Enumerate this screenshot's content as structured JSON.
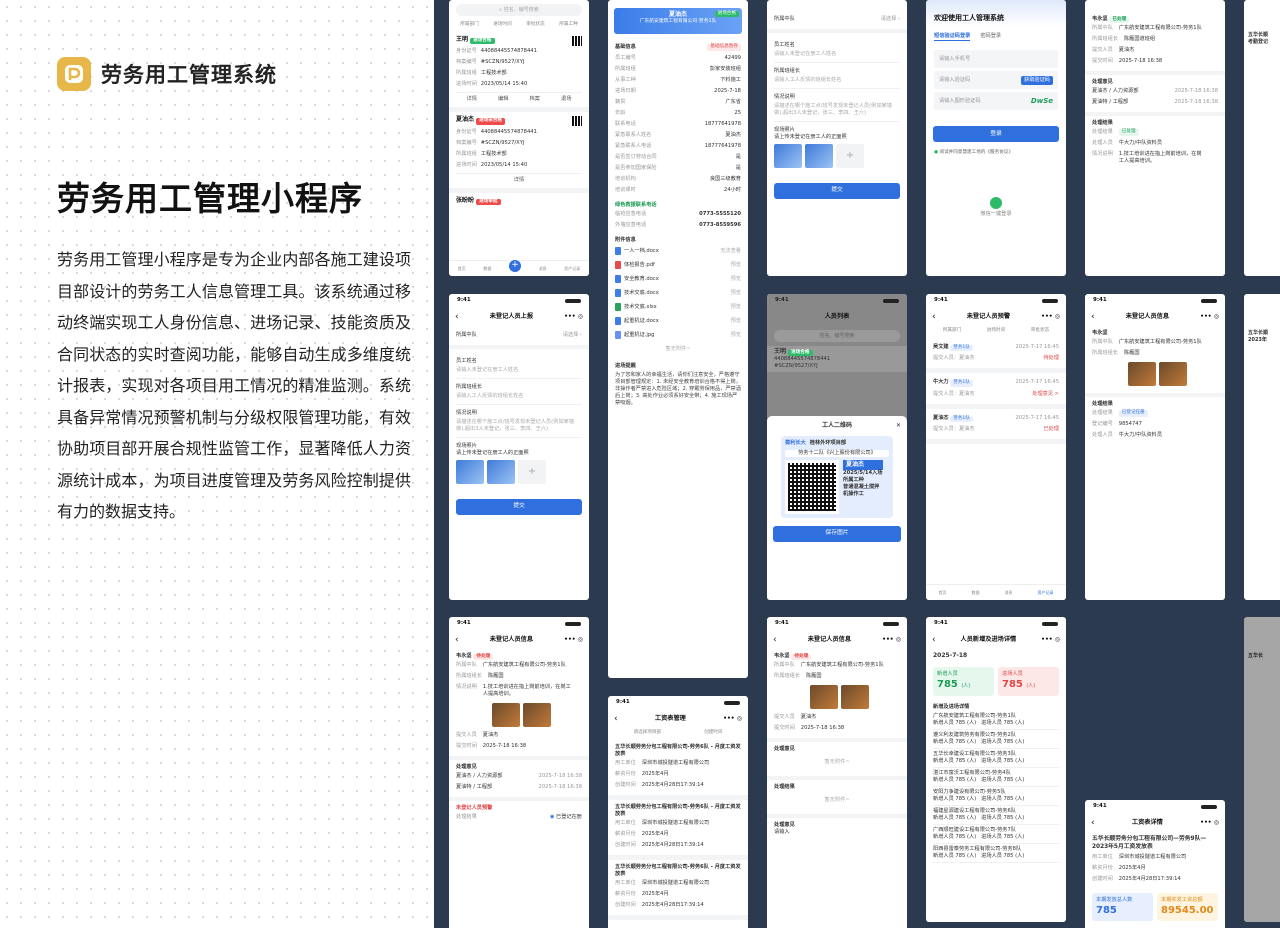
{
  "brand": {
    "name": "劳务用工管理系统",
    "accent": "#e8b74a"
  },
  "hero": {
    "title": "劳务用工管理小程序",
    "description": "劳务用工管理小程序是专为企业内部各施工建设项目部设计的劳务工人信息管理工具。该系统通过移动终端实现工人身份信息、进场记录、技能资质及合同状态的实时查阅功能，能够自动生成多维度统计报表，实现对各项目用工情况的精准监测。系统具备异常情况预警机制与分级权限管理功能，有效协助项目部开展合规性监管工作，显著降低人力资源统计成本，为项目进度管理及劳务风险控制提供有力的数据支持。"
  },
  "common": {
    "time": "9:41",
    "submit": "提交",
    "save": "保存",
    "please_select": "请选择"
  },
  "list": {
    "search_placeholder": "姓名、编号搜索",
    "filters": [
      "所属部门",
      "进场时间",
      "审批状态",
      "所属工种"
    ],
    "cards": [
      {
        "name": "王明",
        "status": "进场合格",
        "rows": [
          [
            "身份证号",
            "44088445574878441"
          ],
          [
            "档案编号",
            "#SCZN/9527/XYJ"
          ],
          [
            "所属班组",
            "工程技术部"
          ],
          [
            "进场时间",
            "2023/05/14 15:40"
          ]
        ],
        "actions": [
          "详情",
          "编辑",
          "档案",
          "退场"
        ]
      },
      {
        "name": "夏油杰",
        "status": "进场未合格",
        "rows": [
          [
            "身份证号",
            "44088445574878441"
          ],
          [
            "档案编号",
            "#SCZN/9527/XYJ"
          ],
          [
            "所属班组",
            "工程技术部"
          ],
          [
            "进场时间",
            "2023/05/14 15:40"
          ]
        ],
        "actions": [
          "详情"
        ]
      },
      {
        "name": "张盼盼",
        "status": "进场审批"
      }
    ],
    "tabs": [
      "首页",
      "数据",
      "新增",
      "消息",
      "资产记录"
    ]
  },
  "detail": {
    "name": "夏油杰",
    "company": "广东航安建筑工程有限公司-劳务1队",
    "status": "进场合格",
    "basic_title": "基础信息",
    "badge": "基础信息暂存",
    "rows": [
      [
        "员工编号",
        "42499"
      ],
      [
        "所属班组",
        "彭家安装班组"
      ],
      [
        "从事工种",
        "下料施工"
      ],
      [
        "进场日期",
        "2025-7-18"
      ],
      [
        "籍贯",
        "广东省"
      ],
      [
        "年龄",
        "25"
      ],
      [
        "联系电话",
        "18777641978"
      ],
      [
        "紧急联系人姓名",
        "夏油杰"
      ],
      [
        "紧急联系人电话",
        "18777641978"
      ],
      [
        "是否签订劳动合同",
        "是"
      ],
      [
        "是否参加国家保险",
        "是"
      ],
      [
        "培训机构",
        "良国三级教育"
      ],
      [
        "培训课时",
        "24小时"
      ]
    ],
    "green_title": "绿色救援联系电话",
    "phones": [
      [
        "临抢应急电话",
        "0773-5555120"
      ],
      [
        "外墙应急电话",
        "0773-8559596"
      ]
    ],
    "attach_title": "附件信息",
    "files": [
      [
        "一人一档.docx",
        "无法查看"
      ],
      [
        "体检报告.pdf",
        "预览"
      ],
      [
        "安全教育.docx",
        "预览"
      ],
      [
        "技术交底.docx",
        "预览"
      ],
      [
        "技术交底.xlsx",
        "预览"
      ],
      [
        "起重机证.docx",
        "预览"
      ],
      [
        "起重机证.jpg",
        "预览"
      ]
    ],
    "more": "暂无附件~",
    "notice_title": "进场提醒",
    "notice": "为了您和家人的幸福生活，请你们注意安全，严格遵守项目部管理规定：1. 未经安全教育培训合格不得上岗，非操作者严禁进入危险区域；2. 穿戴劳保用品，严禁酒后上岗；3. 高处作业必须系好安全带；4. 施工现场严禁吸烟。"
  },
  "report_form": {
    "title": "未登记人员上报",
    "team_label": "所属中队",
    "name_label": "员工姓名",
    "name_hint": "请输入未登记在册工人姓名",
    "leader_label": "所属班组长",
    "leader_hint": "请输入工人反馈的班组长姓名",
    "note_label": "情况说明",
    "note_hint": "请描述在哪个施工点/班号发现未登记人员(例如某墙做),超出3人未登记，张三、李四、王六)",
    "photo_label": "现场照片",
    "photo_hint": "请上传未登记在册工人的正面照"
  },
  "login": {
    "welcome": "欢迎使用工人管理系统",
    "tabs": [
      "短信验证码登录",
      "密码登录"
    ],
    "phone_hint": "请输入手机号",
    "code_hint": "请输入验证码",
    "get_code": "获取验证码",
    "captcha_hint": "请输入图形验证码",
    "captcha": "DwSe",
    "login": "登录",
    "agree": "阅读并同意慧建工地的《服务协议》",
    "wechat": "微信一键登录"
  },
  "record": {
    "name": "韦永坚",
    "status": "已处理",
    "rows": [
      [
        "所属中队",
        "广东航安建筑工程有限公司-劳务1队"
      ],
      [
        "所属班组长",
        "陈雁国道班组"
      ],
      [
        "提交人员",
        "夏油杰"
      ],
      [
        "提交时间",
        "2025-7-18 16:38"
      ]
    ],
    "process_title": "处理意见",
    "process": [
      [
        "夏油杰 / 人力资源部",
        "2025-7-18 16:38"
      ],
      [
        "夏油特 / 工程部",
        "2025-7-18 16:38"
      ]
    ],
    "result_title": "处理结果",
    "result_status": "已处理",
    "handler": "牛大力/中队资料员",
    "handle_desc": "1.技工培训进在指上岗前培训，在岗工人提高培训。"
  },
  "people_list": {
    "title": "人员列表",
    "search_placeholder": "姓名、编号搜索",
    "name": "王明",
    "status": "进场合格",
    "id": "44088445574878441",
    "file_no": "#SCZN/9527/XYJ",
    "qr_title": "工人二维码",
    "company": "葆利长大",
    "project": "桂林外环项目部",
    "team": "劳务十二队《兴上股份有限公司》",
    "worker": "夏油杰",
    "date": "2025/5/14入场",
    "job": "所属工种",
    "job_value": "普通混凝土搅拌机操作工",
    "save": "保存图片"
  },
  "warning": {
    "title": "未登记人员预警",
    "items": [
      {
        "name": "吴文建",
        "tag": "劳务1队",
        "time": "2025-7-17 16:45",
        "state": "待处理"
      },
      {
        "name": "牛大力",
        "tag": "劳务1队",
        "time": "2025-7-17 16:45",
        "state": "处理意见 >"
      },
      {
        "name": "夏油杰",
        "tag": "劳务1队",
        "time": "2025-7-17 16:45",
        "state": "已处理"
      }
    ]
  },
  "report_detail": {
    "title": "未登记人员信息",
    "name": "韦永坚",
    "status": "已处理",
    "rows": [
      [
        "所属中队",
        "广东航安建筑工程有限公司-劳务1队"
      ],
      [
        "所属班组长",
        "陈雁国"
      ]
    ],
    "handler_title": "处理结果",
    "handler_status": "已登记在册",
    "register_no": "9854747",
    "handler": "牛大力/中队资料员"
  },
  "payroll": {
    "title": "工资表管理",
    "filters": [
      "请选择项目部",
      "创建时间"
    ],
    "items": [
      {
        "title": "五华长顺劳务分包工程有限公司-劳务6队 - 月度工资发放表",
        "unit": "深圳市城投隧道工程有限公司",
        "month": "2025年4月",
        "time": "2025年4月28日17:39:14"
      },
      {
        "title": "五华长顺劳务分包工程有限公司-劳务6队 - 月度工资发放表",
        "unit": "深圳市城投隧道工程有限公司",
        "month": "2025年4月",
        "time": "2025年4月28日17:39:14"
      },
      {
        "title": "五华长顺劳务分包工程有限公司-劳务6队 - 月度工资发放表",
        "unit": "深圳市城投隧道工程有限公司",
        "month": "2025年4月",
        "time": "2025年4月28日17:39:14"
      }
    ]
  },
  "entry_stats": {
    "title": "人员新增及进场详情",
    "date": "2025-7-18",
    "new_label": "新增人员",
    "new_value": "785",
    "in_label": "进场人员",
    "in_value": "785",
    "unit": "(人)",
    "list_title": "新增及进场详情",
    "items": [
      "广东航安建筑工程有限公司-劳务1队",
      "遵义利友建筑劳务有限公司-劳务2队",
      "五华长幸建设工程有限公司-劳务3队",
      "湛江市富沃工程有限公司-劳务4队",
      "安阳力争建设有限公司-劳务5队",
      "福建星源建设工程有限公司-劳务6队",
      "广西顺旺建设工程有限公司-劳务7队",
      "阳西县雷泰劳务工程有限公司-劳务8队"
    ]
  },
  "salary_detail": {
    "title": "工资表详情",
    "headline": "五华长顺劳务分包工程有限公司—劳务9队—2023年5月工资发放表",
    "unit": "深圳市城投隧道工程有限公司",
    "month": "2025年4月",
    "time": "2025年4月28日17:39:14",
    "total_people_label": "本期发放总人数",
    "total_people": "785",
    "total_amount_label": "本期实发工资总额",
    "total_amount": "89545.00"
  },
  "chart_colors": {
    "primary": "#2f6fde",
    "green": "#2dbb6a",
    "red": "#ef4b4b",
    "bg": "#2c3a4f"
  }
}
